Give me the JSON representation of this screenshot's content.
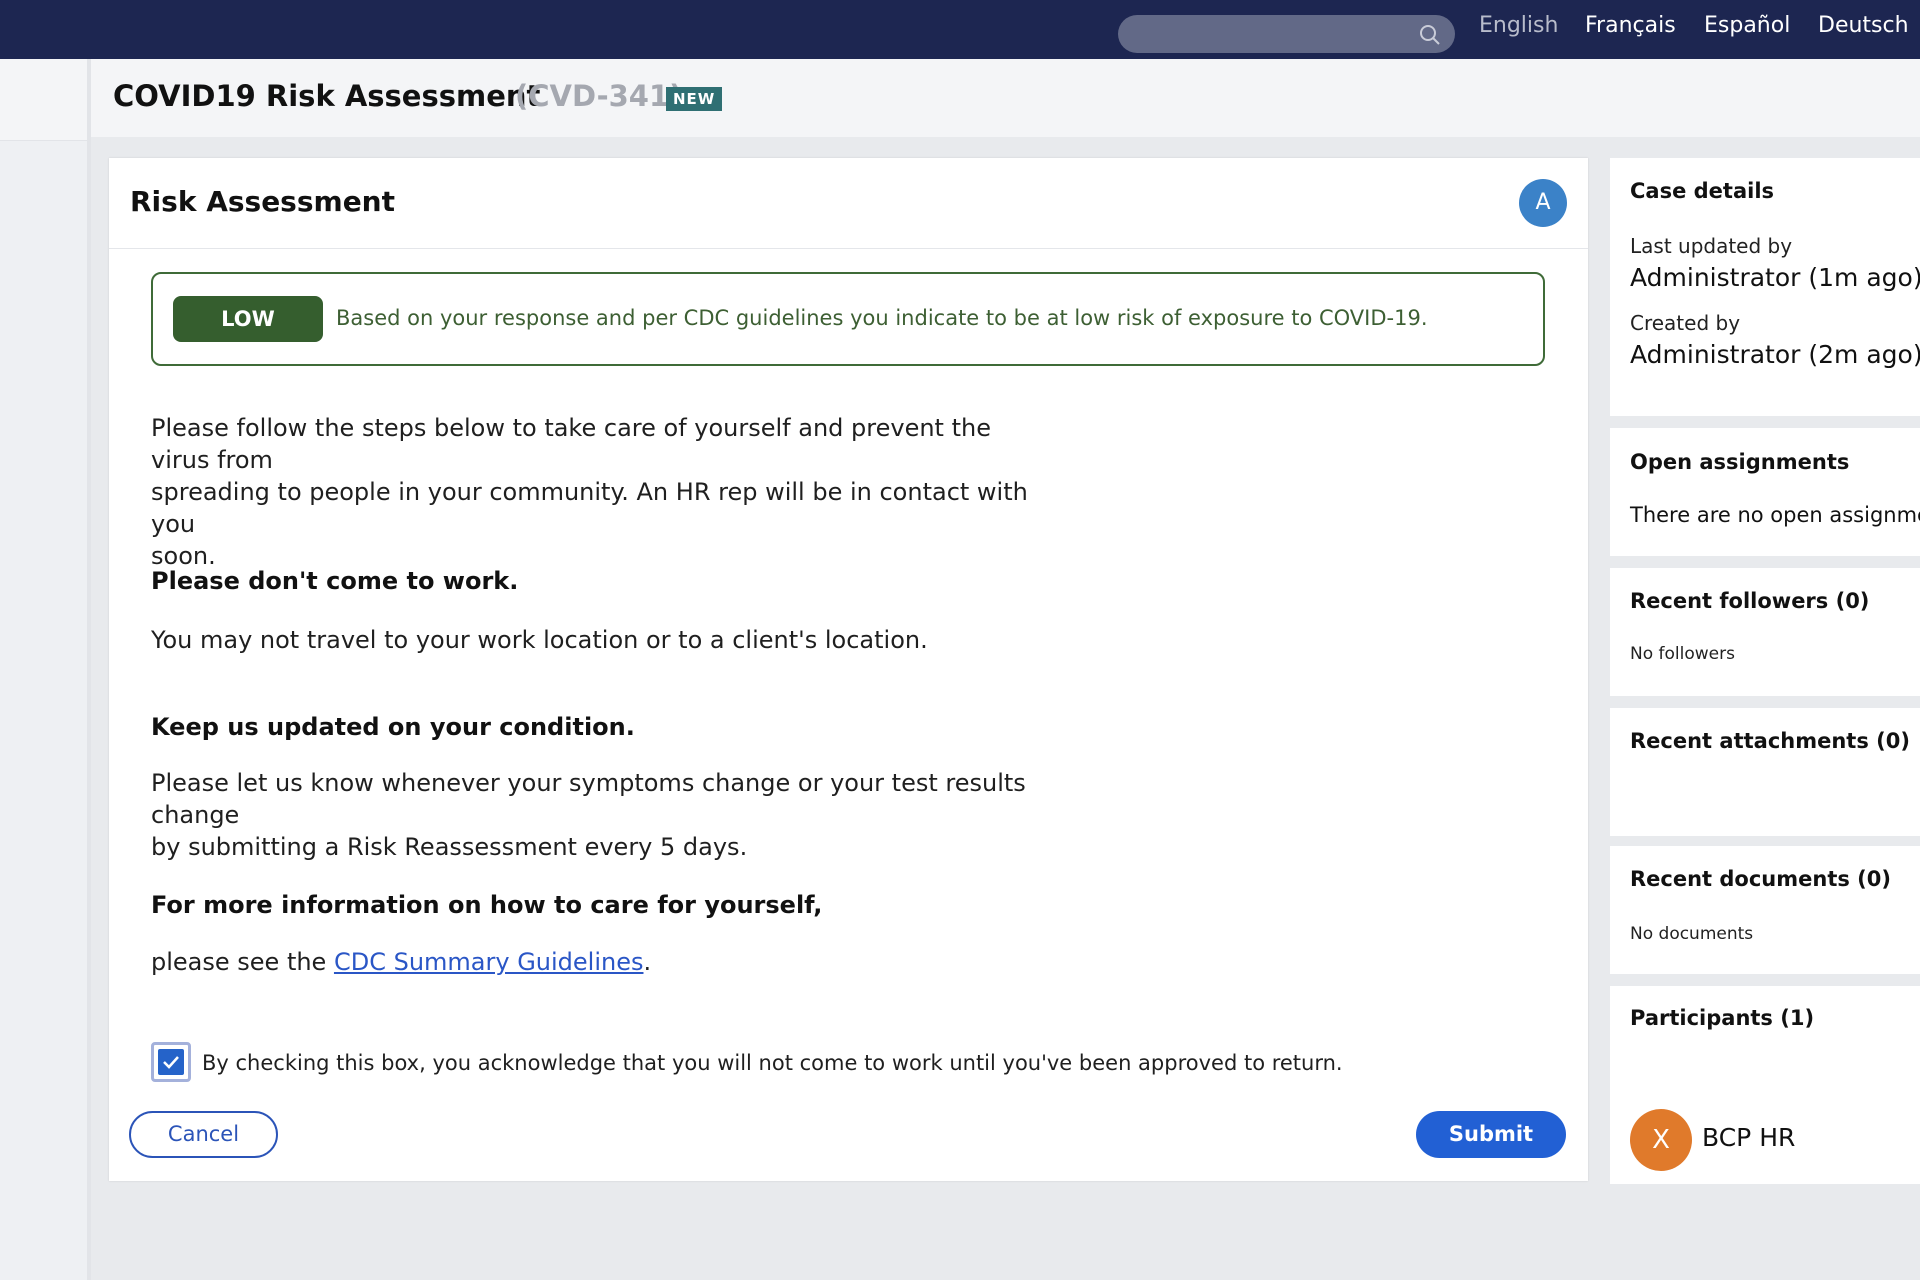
{
  "topbar": {
    "search_placeholder": "",
    "languages": [
      "English",
      "Français",
      "Español",
      "Deutsch"
    ],
    "active_language": "English"
  },
  "header": {
    "title": "COVID19 Risk Assessment",
    "case_id": "(CVD-341)",
    "badge": "NEW"
  },
  "assessment": {
    "title": "Risk Assessment",
    "avatar_initial": "A",
    "risk_level": "LOW",
    "risk_message": "Based on your response and per CDC guidelines you indicate to be at low risk of exposure to COVID-19.",
    "intro_line1": "Please follow the steps below to take care of yourself and prevent the virus from",
    "intro_line2": "spreading to people in your community. An HR rep will be in contact with you",
    "intro_line3": "soon.",
    "heading1": "Please don't come to work.",
    "text1": "You may not travel to your work location or to a client's location.",
    "heading2": "Keep us updated on your condition.",
    "text2_line1": "Please let us know whenever your symptoms change or your test results change",
    "text2_line2": "by submitting a Risk Reassessment every 5 days.",
    "heading3": "For more information on how to care for yourself,",
    "text3_prefix": "please see the ",
    "link_text": "CDC Summary Guidelines",
    "text3_suffix": ".",
    "acknowledge_checked": true,
    "acknowledge_label": "By checking this box, you acknowledge that you will not come to work until you've been approved to return.",
    "cancel_label": "Cancel",
    "submit_label": "Submit"
  },
  "sidebar": {
    "case_details": {
      "title": "Case details",
      "last_updated_label": "Last updated by",
      "last_updated_value": "Administrator (1m ago)",
      "created_label": "Created by",
      "created_value": "Administrator (2m ago)"
    },
    "open_assignments": {
      "title": "Open assignments",
      "text": "There are no open assignmer"
    },
    "recent_followers": {
      "title": "Recent followers (0)",
      "text": "No followers"
    },
    "recent_attachments": {
      "title": "Recent attachments (0)"
    },
    "recent_documents": {
      "title": "Recent documents (0)",
      "text": "No documents"
    },
    "participants": {
      "title": "Participants (1)",
      "avatar_initial": "X",
      "name": "BCP HR"
    }
  },
  "colors": {
    "topbar": "#1d2651",
    "risk_green": "#355e2e",
    "primary_blue": "#2260d4",
    "new_badge": "#2f6f73",
    "avatar_blue": "#3b82c8",
    "avatar_orange": "#e07a2b"
  },
  "icons": {
    "search": "search-icon",
    "check": "checkmark-icon"
  }
}
